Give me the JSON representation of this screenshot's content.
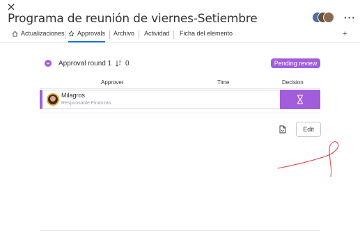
{
  "header": {
    "title": "Programa de reunión de viernes-Setiembre"
  },
  "tabs": [
    {
      "label": "Actualizaciones"
    },
    {
      "label": "Approvals"
    },
    {
      "label": "Archivo"
    },
    {
      "label": "Actividad"
    },
    {
      "label": "Ficha del elemento"
    }
  ],
  "approval": {
    "round_label": "Approval round 1",
    "count": "0",
    "status": "Pending review",
    "status_color": "#a25ddc",
    "columns": {
      "approver": "Approver",
      "time": "Time",
      "decision": "Decision"
    },
    "rows": [
      {
        "name": "Milagros",
        "role": "Responsable Finanzas",
        "time": "",
        "decision_icon": "hourglass-icon"
      }
    ],
    "edit_label": "Edit"
  },
  "colors": {
    "accent": "#a25ddc",
    "annotation": "#e53935"
  }
}
